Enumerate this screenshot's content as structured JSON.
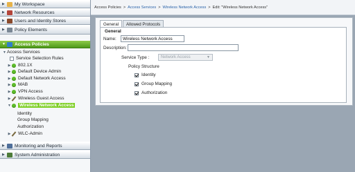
{
  "sidebar": {
    "top_sections": [
      {
        "label": "My Workspace"
      },
      {
        "label": "Network Resources"
      },
      {
        "label": "Users and Identity Stores"
      },
      {
        "label": "Policy Elements"
      }
    ],
    "active_section": {
      "label": "Access Policies"
    },
    "tree": {
      "access_services": "Access Services",
      "service_selection_rules": "Service Selection Rules",
      "services": [
        {
          "label": "802.1X"
        },
        {
          "label": "Default Device Admin"
        },
        {
          "label": "Default Network Access"
        },
        {
          "label": "MAB"
        },
        {
          "label": "VPN Access"
        },
        {
          "label": "Wireless Guest Access"
        },
        {
          "label": "Wireless Network Access"
        }
      ],
      "wna_children": [
        "Identity",
        "Group Mapping",
        "Authorization"
      ],
      "wlc_admin": "WLC-Admin"
    },
    "bottom_sections": [
      {
        "label": "Monitoring and Reports"
      },
      {
        "label": "System Administration"
      }
    ]
  },
  "breadcrumb": {
    "root": "Access Policies",
    "sep": ">",
    "link1": "Access Services",
    "link2": "Wireless Network Access",
    "current": "Edit: \"Wireless Network Access\""
  },
  "tabs": [
    "General",
    "Allowed Protocols"
  ],
  "form": {
    "section_title": "General",
    "name_label": "Name:",
    "name_value": "Wireless Network Access",
    "description_label": "Description:",
    "description_value": "",
    "service_type_label": "Service Type :",
    "service_type_value": "Network Access",
    "policy_structure_label": "Policy Structure",
    "checks": [
      {
        "label": "Identity",
        "checked": true
      },
      {
        "label": "Group Mapping",
        "checked": true
      },
      {
        "label": "Authorization",
        "checked": true
      }
    ]
  },
  "colors": {
    "accent_green": "#6cbf2a",
    "link_blue": "#2a62a8"
  }
}
